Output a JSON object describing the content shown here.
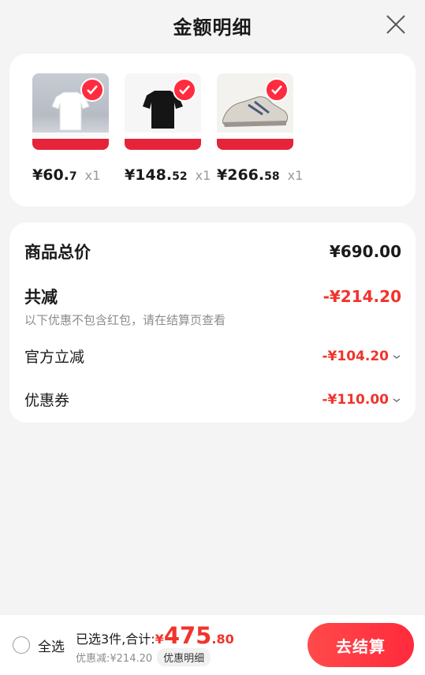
{
  "header": {
    "title": "金额明细",
    "close_icon": "close-icon"
  },
  "products": [
    {
      "price_int": "¥60.",
      "price_dec": "7",
      "qty": "x1",
      "image": "white-tshirt",
      "checked": true
    },
    {
      "price_int": "¥148.",
      "price_dec": "52",
      "qty": "x1",
      "image": "black-tshirt",
      "checked": true
    },
    {
      "price_int": "¥266.",
      "price_dec": "58",
      "qty": "x1",
      "image": "running-shoe",
      "checked": true
    }
  ],
  "summary": {
    "total_label": "商品总价",
    "total_value": "¥690.00",
    "discount_label": "共减",
    "discount_value": "-¥214.20",
    "discount_note": "以下优惠不包含红包，请在结算页查看",
    "items": [
      {
        "label": "官方立减",
        "value": "-¥104.20"
      },
      {
        "label": "优惠券",
        "value": "-¥110.00"
      }
    ]
  },
  "bottom": {
    "select_all": "全选",
    "count_text": "已选3件,合计:",
    "currency": "¥",
    "total_int": "475",
    "total_dec": ".80",
    "saved_text": "优惠减:¥214.20",
    "detail_label": "优惠明细",
    "checkout_label": "去结算"
  },
  "colors": {
    "accent": "#f0342c",
    "button": "#ff2a3c",
    "background": "#f4f4f5"
  }
}
